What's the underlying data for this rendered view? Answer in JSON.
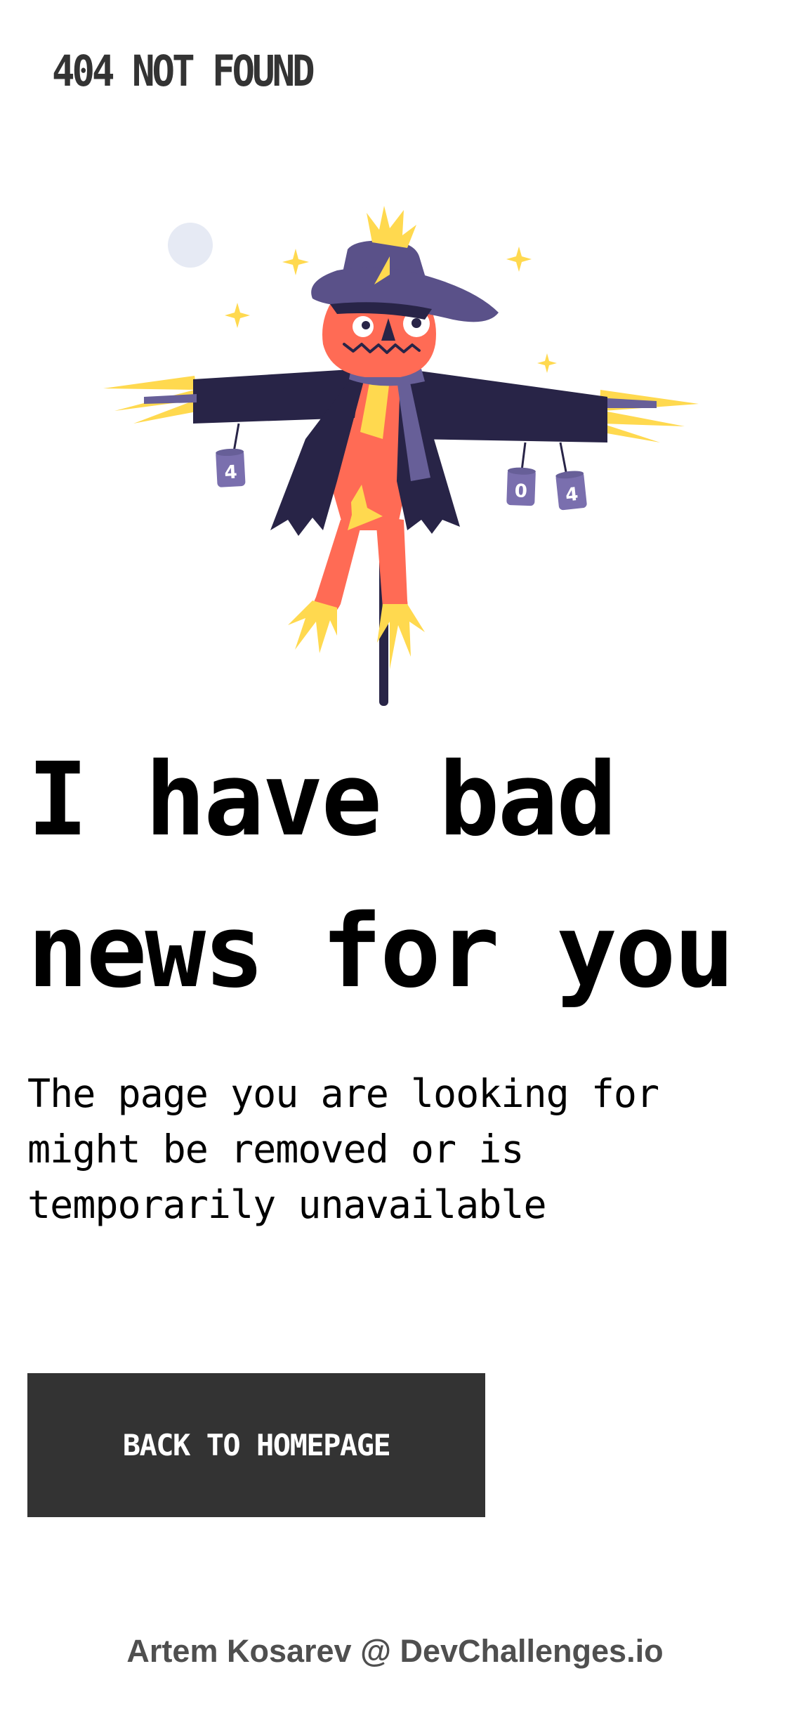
{
  "header": {
    "brand": "404 NOT FOUND"
  },
  "illustration": {
    "name": "scarecrow",
    "cans": [
      "4",
      "0",
      "4"
    ],
    "colors": {
      "hat": "#5a5189",
      "coat": "#282447",
      "skin": "#ff6b55",
      "straw": "#ffd94f",
      "scarf": "#675f98",
      "moon": "#e6eaf4"
    }
  },
  "main": {
    "headline_line1": "I have bad",
    "headline_line2": "news for you",
    "description_line1": "The page you are looking for",
    "description_line2": "might be removed or is",
    "description_line3": "temporarily unavailable",
    "button_label": "BACK TO HOMEPAGE"
  },
  "footer": {
    "credit": "Artem Kosarev @ DevChallenges.io"
  },
  "theme": {
    "button_bg": "#333333",
    "button_text": "#ffffff",
    "text": "#000000",
    "footer_text": "#4f4f4f"
  }
}
